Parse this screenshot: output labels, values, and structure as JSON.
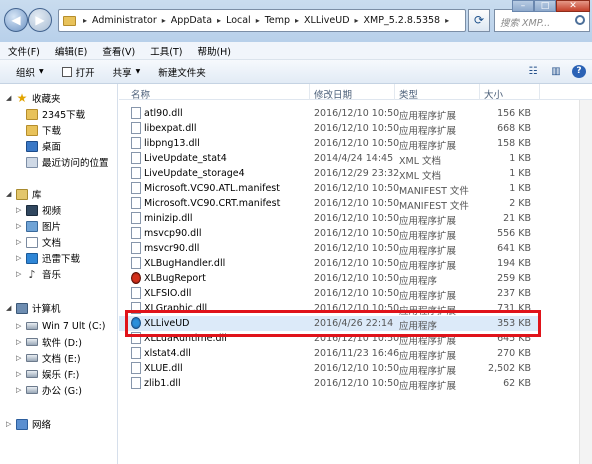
{
  "breadcrumb": [
    "Administrator",
    "AppData",
    "Local",
    "Temp",
    "XLLiveUD",
    "XMP_5.2.8.5358"
  ],
  "search": {
    "placeholder": "搜索 XMP..."
  },
  "menu": [
    "文件(F)",
    "编辑(E)",
    "查看(V)",
    "工具(T)",
    "帮助(H)"
  ],
  "toolbar": {
    "organize": "组织",
    "open": "打开",
    "share": "共享",
    "new_folder": "新建文件夹"
  },
  "nav": {
    "favorites": "收藏夹",
    "fav_items": [
      "2345下载",
      "下载",
      "桌面",
      "最近访问的位置"
    ],
    "library": "库",
    "lib_items": [
      "视频",
      "图片",
      "文档",
      "迅雷下载",
      "音乐"
    ],
    "computer": "计算机",
    "drives": [
      "Win 7 Ult (C:)",
      "软件 (D:)",
      "文档 (E:)",
      "娱乐 (F:)",
      "办公 (G:)"
    ],
    "network": "网络"
  },
  "columns": {
    "name": "名称",
    "date": "修改日期",
    "type": "类型",
    "size": "大小"
  },
  "files": [
    {
      "name": "atl90.dll",
      "date": "2016/12/10 10:50",
      "type": "应用程序扩展",
      "size": "156 KB",
      "icon": "dll"
    },
    {
      "name": "libexpat.dll",
      "date": "2016/12/10 10:50",
      "type": "应用程序扩展",
      "size": "668 KB",
      "icon": "dll"
    },
    {
      "name": "libpng13.dll",
      "date": "2016/12/10 10:50",
      "type": "应用程序扩展",
      "size": "158 KB",
      "icon": "dll"
    },
    {
      "name": "LiveUpdate_stat4",
      "date": "2014/4/24 14:45",
      "type": "XML 文档",
      "size": "1 KB",
      "icon": "file"
    },
    {
      "name": "LiveUpdate_storage4",
      "date": "2016/12/29 23:32",
      "type": "XML 文档",
      "size": "1 KB",
      "icon": "file"
    },
    {
      "name": "Microsoft.VC90.ATL.manifest",
      "date": "2016/12/10 10:50",
      "type": "MANIFEST 文件",
      "size": "1 KB",
      "icon": "file"
    },
    {
      "name": "Microsoft.VC90.CRT.manifest",
      "date": "2016/12/10 10:50",
      "type": "MANIFEST 文件",
      "size": "2 KB",
      "icon": "file"
    },
    {
      "name": "minizip.dll",
      "date": "2016/12/10 10:50",
      "type": "应用程序扩展",
      "size": "21 KB",
      "icon": "dll"
    },
    {
      "name": "msvcp90.dll",
      "date": "2016/12/10 10:50",
      "type": "应用程序扩展",
      "size": "556 KB",
      "icon": "dll"
    },
    {
      "name": "msvcr90.dll",
      "date": "2016/12/10 10:50",
      "type": "应用程序扩展",
      "size": "641 KB",
      "icon": "dll"
    },
    {
      "name": "XLBugHandler.dll",
      "date": "2016/12/10 10:50",
      "type": "应用程序扩展",
      "size": "194 KB",
      "icon": "dll"
    },
    {
      "name": "XLBugReport",
      "date": "2016/12/10 10:50",
      "type": "应用程序",
      "size": "259 KB",
      "icon": "bug"
    },
    {
      "name": "XLFSIO.dll",
      "date": "2016/12/10 10:50",
      "type": "应用程序扩展",
      "size": "237 KB",
      "icon": "dll"
    },
    {
      "name": "XLGraphic.dll",
      "date": "2016/12/10 10:50",
      "type": "应用程序扩展",
      "size": "731 KB",
      "icon": "dll"
    },
    {
      "name": "XLLiveUD",
      "date": "2016/4/26 22:14",
      "type": "应用程序",
      "size": "353 KB",
      "icon": "exe",
      "selected": true
    },
    {
      "name": "XLLuaRuntime.dll",
      "date": "2016/12/10 10:50",
      "type": "应用程序扩展",
      "size": "645 KB",
      "icon": "dll"
    },
    {
      "name": "xlstat4.dll",
      "date": "2016/11/23 16:46",
      "type": "应用程序扩展",
      "size": "270 KB",
      "icon": "dll"
    },
    {
      "name": "XLUE.dll",
      "date": "2016/12/10 10:50",
      "type": "应用程序扩展",
      "size": "2,502 KB",
      "icon": "dll"
    },
    {
      "name": "zlib1.dll",
      "date": "2016/12/10 10:50",
      "type": "应用程序扩展",
      "size": "62 KB",
      "icon": "dll"
    }
  ]
}
